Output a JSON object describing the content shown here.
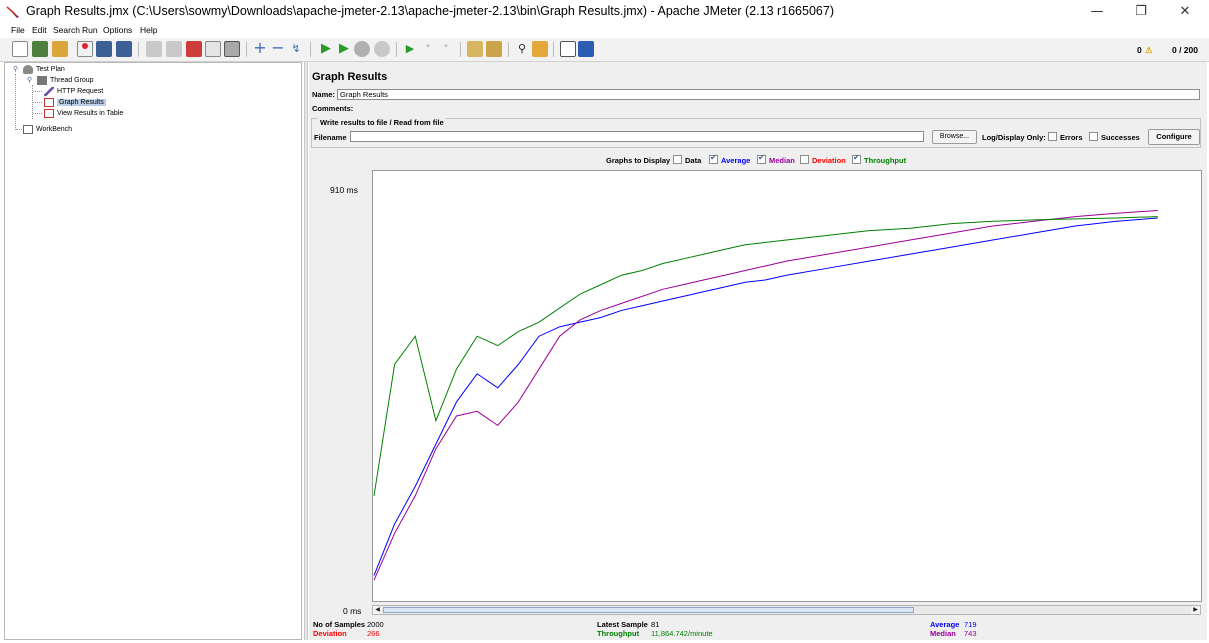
{
  "window": {
    "title": "Graph Results.jmx (C:\\Users\\sowmy\\Downloads\\apache-jmeter-2.13\\apache-jmeter-2.13\\bin\\Graph Results.jmx) - Apache JMeter (2.13 r1665067)",
    "minimize": "—",
    "restore": "❐",
    "close": "✕"
  },
  "menu": [
    "File",
    "Edit",
    "Search",
    "Run",
    "Options",
    "Help"
  ],
  "toolbar": {
    "warnings": "0",
    "threads": "0 / 200",
    "icons": [
      "new-icon",
      "templates-icon",
      "open-icon",
      "close-icon",
      "save-icon",
      "save-as-icon",
      "undo-icon",
      "redo-icon",
      "cut-icon",
      "copy-icon",
      "paste-icon",
      "expand-icon",
      "collapse-icon",
      "toggle-icon",
      "start-icon",
      "start-no-pause-icon",
      "stop-icon",
      "shutdown-icon",
      "remote-start-icon",
      "remote-stop-icon",
      "remote-shutdown-icon",
      "clear-icon",
      "clear-all-icon",
      "search-icon",
      "reset-search-icon",
      "function-helper-icon",
      "help-icon"
    ]
  },
  "tree": {
    "items": [
      {
        "label": "Test Plan",
        "icon": "test-plan-icon"
      },
      {
        "label": "Thread Group",
        "icon": "thread-group-icon"
      },
      {
        "label": "HTTP Request",
        "icon": "http-request-icon"
      },
      {
        "label": "Graph Results",
        "icon": "graph-results-icon",
        "selected": true
      },
      {
        "label": "View Results in Table",
        "icon": "view-results-table-icon"
      },
      {
        "label": "WorkBench",
        "icon": "workbench-icon"
      }
    ]
  },
  "panel": {
    "title": "Graph Results",
    "name_label": "Name:",
    "name_value": "Graph Results",
    "comments_label": "Comments:",
    "comments_value": "",
    "file_legend": "Write results to file / Read from file",
    "filename_label": "Filename",
    "filename_value": "",
    "browse_label": "Browse...",
    "log_display_label": "Log/Display Only:",
    "errors_label": "Errors",
    "successes_label": "Successes",
    "configure_label": "Configure"
  },
  "graphs_to_display": {
    "label": "Graphs to Display",
    "options": [
      {
        "label": "Data",
        "checked": false,
        "color": "#000000"
      },
      {
        "label": "Average",
        "checked": true,
        "color": "#0000ff"
      },
      {
        "label": "Median",
        "checked": true,
        "color": "#990099"
      },
      {
        "label": "Deviation",
        "checked": false,
        "color": "#ff0000"
      },
      {
        "label": "Throughput",
        "checked": true,
        "color": "#008000"
      }
    ]
  },
  "chart_data": {
    "type": "line",
    "ylabel_top": "910 ms",
    "ylabel_bottom": "0 ms",
    "ylim": [
      0,
      910
    ],
    "x_samples": [
      0,
      50,
      100,
      150,
      200,
      250,
      300,
      350,
      400,
      450,
      500,
      550,
      600,
      650,
      700,
      750,
      800,
      850,
      900,
      950,
      1000,
      1100,
      1200,
      1300,
      1400,
      1500,
      1600,
      1700,
      1800,
      1900,
      2000
    ],
    "series": [
      {
        "color": "#0000ff",
        "values": [
          50,
          160,
          240,
          330,
          420,
          480,
          450,
          500,
          560,
          580,
          590,
          600,
          615,
          625,
          635,
          645,
          655,
          665,
          675,
          680,
          690,
          705,
          720,
          735,
          750,
          765,
          780,
          795,
          805,
          812,
          719
        ]
      },
      {
        "color": "#990099",
        "values": [
          40,
          140,
          220,
          320,
          390,
          400,
          370,
          420,
          490,
          560,
          595,
          615,
          630,
          645,
          660,
          670,
          680,
          690,
          700,
          710,
          720,
          735,
          750,
          765,
          780,
          795,
          805,
          815,
          822,
          828,
          743
        ]
      },
      {
        "color": "#008000",
        "values": [
          220,
          500,
          560,
          380,
          490,
          560,
          540,
          570,
          590,
          620,
          650,
          670,
          690,
          700,
          715,
          725,
          735,
          745,
          755,
          760,
          765,
          775,
          785,
          790,
          800,
          805,
          808,
          810,
          812,
          815,
          810
        ]
      }
    ]
  },
  "stats": {
    "samples_label": "No of Samples",
    "samples_value": "2000",
    "deviation_label": "Deviation",
    "deviation_value": "266",
    "latest_label": "Latest Sample",
    "latest_value": "81",
    "throughput_label": "Throughput",
    "throughput_value": "11,864.742/minute",
    "average_label": "Average",
    "average_value": "719",
    "median_label": "Median",
    "median_value": "743"
  }
}
